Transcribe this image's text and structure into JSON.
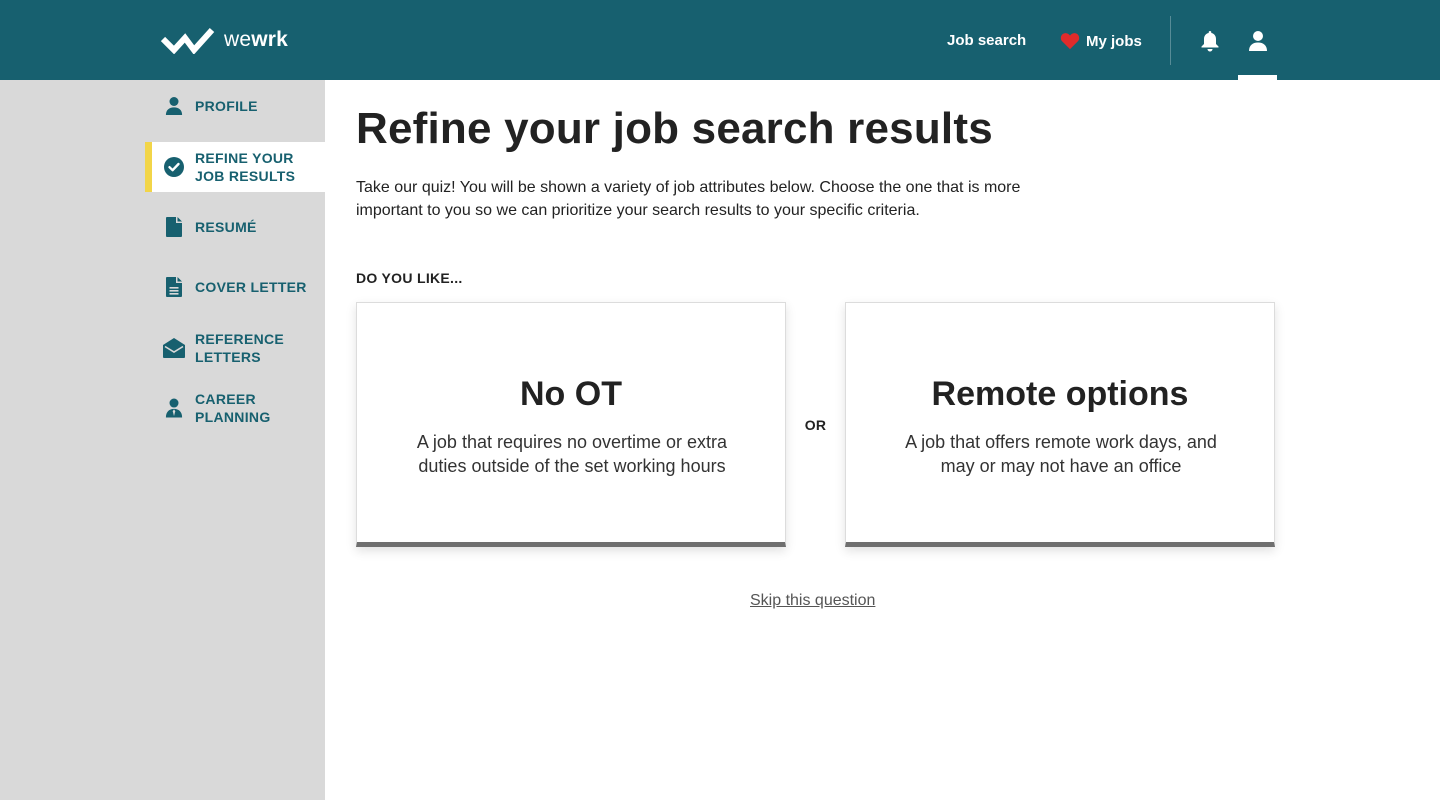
{
  "header": {
    "logo_light": "we",
    "logo_bold": "wrk",
    "nav": {
      "job_search": "Job search",
      "my_jobs": "My jobs"
    },
    "icons": {
      "notifications": "bell-icon",
      "account": "user-icon",
      "my_jobs": "heart-icon"
    },
    "colors": {
      "bar": "#17606f",
      "heart": "#e02b2b"
    }
  },
  "sidebar": {
    "active_index": 1,
    "items": [
      {
        "label": "PROFILE",
        "icon": "user-icon"
      },
      {
        "label": "REFINE YOUR JOB RESULTS",
        "icon": "check-circle-icon"
      },
      {
        "label": "RESUMÉ",
        "icon": "document-icon"
      },
      {
        "label": "COVER LETTER",
        "icon": "file-lines-icon"
      },
      {
        "label": "REFERENCE LETTERS",
        "icon": "envelope-open-icon"
      },
      {
        "label": "CAREER PLANNING",
        "icon": "user-tie-icon"
      }
    ],
    "colors": {
      "background": "#d9d9d9",
      "accent": "#f2d548",
      "text": "#17606f"
    }
  },
  "main": {
    "title": "Refine your job search results",
    "intro": "Take our quiz! You will be shown a variety of job attributes below. Choose the one that is more important to you so we can prioritize your search results to your specific criteria.",
    "question": "DO YOU LIKE...",
    "options": [
      {
        "title": "No OT",
        "description": "A job that requires no overtime or extra duties outside of the set working hours"
      },
      {
        "title": "Remote options",
        "description": "A job that offers remote work days, and may or may not have an office"
      }
    ],
    "or_label": "OR",
    "skip_label": "Skip this question"
  }
}
